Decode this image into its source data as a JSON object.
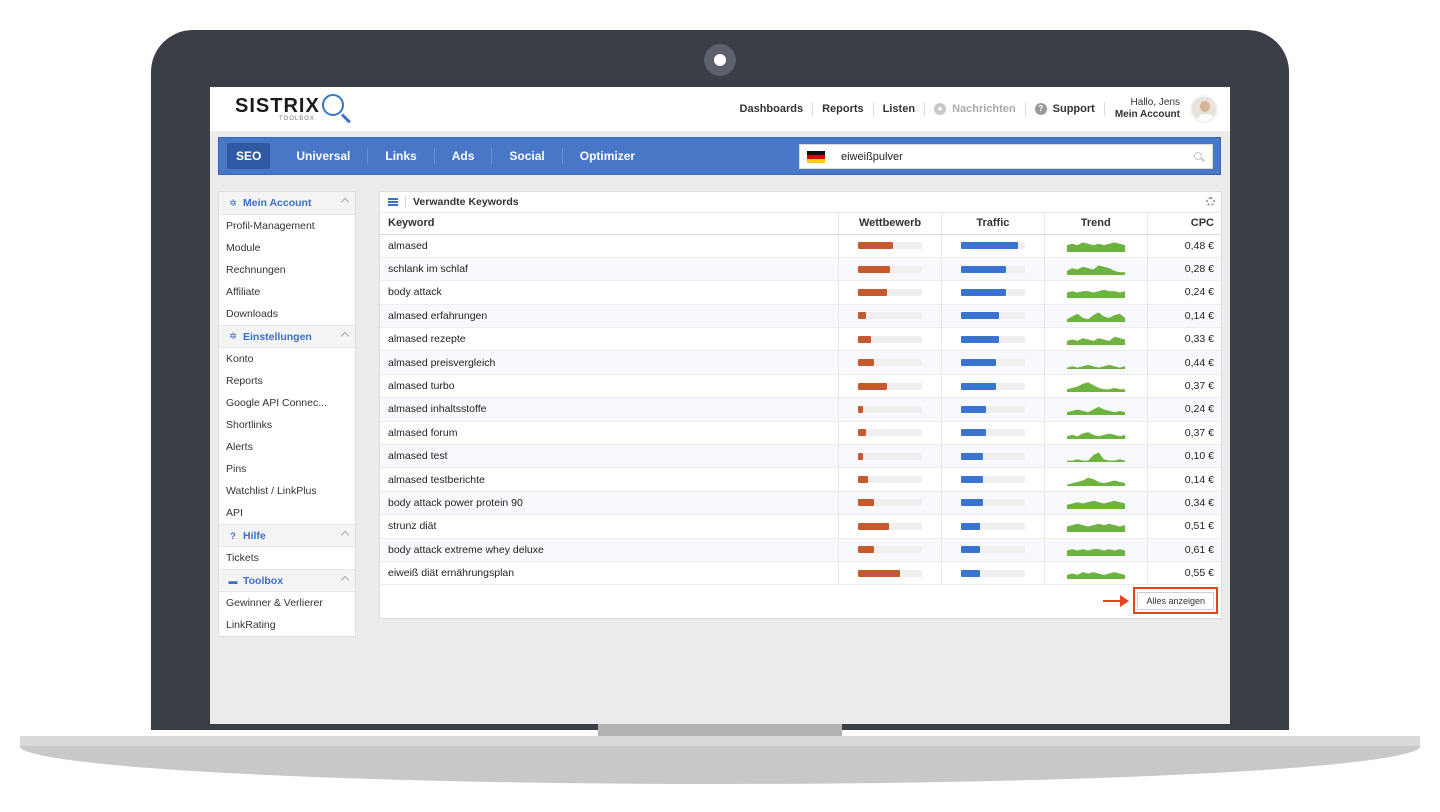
{
  "header": {
    "logo_text": "SISTRIX",
    "logo_sub": "TOOLBOX",
    "nav": [
      "Dashboards",
      "Reports",
      "Listen",
      "Nachrichten",
      "Support"
    ],
    "user_greeting": "Hallo, Jens",
    "user_account": "Mein Account"
  },
  "mainnav": {
    "tabs": [
      "SEO",
      "Universal",
      "Links",
      "Ads",
      "Social",
      "Optimizer"
    ],
    "active_tab": "SEO",
    "search_value": "eiweißpulver",
    "country_flag": "germany-flag"
  },
  "sidebar": {
    "sections": [
      {
        "title": "Mein Account",
        "icon": "gear-icon",
        "items": [
          "Profil-Management",
          "Module",
          "Rechnungen",
          "Affiliate",
          "Downloads"
        ]
      },
      {
        "title": "Einstellungen",
        "icon": "gear-icon",
        "items": [
          "Konto",
          "Reports",
          "Google API Connec...",
          "Shortlinks",
          "Alerts",
          "Pins",
          "Watchlist / LinkPlus",
          "API"
        ]
      },
      {
        "title": "Hilfe",
        "icon": "question-icon",
        "items": [
          "Tickets"
        ]
      },
      {
        "title": "Toolbox",
        "icon": "briefcase-icon",
        "items": [
          "Gewinner & Verlierer",
          "LinkRating"
        ]
      }
    ]
  },
  "panel": {
    "title": "Verwandte Keywords",
    "columns": [
      "Keyword",
      "Wettbewerb",
      "Traffic",
      "Trend",
      "CPC"
    ],
    "show_all_label": "Alles anzeigen",
    "rows": [
      {
        "keyword": "almased",
        "competition": 0.55,
        "traffic": 0.9,
        "trend": [
          5,
          6,
          5,
          7,
          6,
          5,
          6,
          5,
          6,
          7,
          6,
          5
        ],
        "cpc": "0,48 €"
      },
      {
        "keyword": "schlank im schlaf",
        "competition": 0.5,
        "traffic": 0.7,
        "trend": [
          3,
          5,
          4,
          6,
          5,
          4,
          7,
          6,
          5,
          3,
          2,
          2
        ],
        "cpc": "0,28 €"
      },
      {
        "keyword": "body attack",
        "competition": 0.45,
        "traffic": 0.7,
        "trend": [
          4,
          5,
          4,
          5,
          5,
          4,
          5,
          6,
          5,
          5,
          4,
          5
        ],
        "cpc": "0,24 €"
      },
      {
        "keyword": "almased erfahrungen",
        "competition": 0.12,
        "traffic": 0.6,
        "trend": [
          2,
          4,
          6,
          3,
          2,
          5,
          7,
          4,
          3,
          5,
          6,
          3
        ],
        "cpc": "0,14 €"
      },
      {
        "keyword": "almased rezepte",
        "competition": 0.2,
        "traffic": 0.6,
        "trend": [
          3,
          4,
          3,
          5,
          4,
          3,
          5,
          4,
          3,
          6,
          5,
          4
        ],
        "cpc": "0,33 €"
      },
      {
        "keyword": "almased preisvergleich",
        "competition": 0.25,
        "traffic": 0.55,
        "trend": [
          1,
          2,
          1,
          2,
          3,
          2,
          1,
          2,
          3,
          2,
          1,
          2
        ],
        "cpc": "0,44 €"
      },
      {
        "keyword": "almased turbo",
        "competition": 0.45,
        "traffic": 0.55,
        "trend": [
          2,
          3,
          4,
          6,
          7,
          5,
          3,
          2,
          2,
          3,
          2,
          2
        ],
        "cpc": "0,37 €"
      },
      {
        "keyword": "almased inhaltsstoffe",
        "competition": 0.08,
        "traffic": 0.4,
        "trend": [
          2,
          3,
          4,
          3,
          2,
          4,
          6,
          4,
          3,
          2,
          3,
          2
        ],
        "cpc": "0,24 €"
      },
      {
        "keyword": "almased forum",
        "competition": 0.12,
        "traffic": 0.4,
        "trend": [
          2,
          3,
          2,
          4,
          5,
          3,
          2,
          3,
          4,
          3,
          2,
          3
        ],
        "cpc": "0,37 €"
      },
      {
        "keyword": "almased test",
        "competition": 0.08,
        "traffic": 0.35,
        "trend": [
          1,
          1,
          2,
          1,
          1,
          5,
          7,
          2,
          1,
          1,
          2,
          1
        ],
        "cpc": "0,10 €"
      },
      {
        "keyword": "almased testberichte",
        "competition": 0.15,
        "traffic": 0.35,
        "trend": [
          1,
          2,
          3,
          4,
          6,
          5,
          3,
          2,
          3,
          4,
          3,
          2
        ],
        "cpc": "0,14 €"
      },
      {
        "keyword": "body attack power protein 90",
        "competition": 0.25,
        "traffic": 0.35,
        "trend": [
          3,
          4,
          5,
          4,
          5,
          6,
          5,
          4,
          5,
          6,
          5,
          4
        ],
        "cpc": "0,34 €"
      },
      {
        "keyword": "strunz diät",
        "competition": 0.48,
        "traffic": 0.3,
        "trend": [
          4,
          5,
          6,
          5,
          4,
          5,
          6,
          5,
          6,
          5,
          4,
          5
        ],
        "cpc": "0,51 €"
      },
      {
        "keyword": "body attack extreme whey deluxe",
        "competition": 0.25,
        "traffic": 0.3,
        "trend": [
          4,
          5,
          4,
          5,
          4,
          5,
          5,
          4,
          5,
          4,
          5,
          4
        ],
        "cpc": "0,61 €"
      },
      {
        "keyword": "eiweiß diät ernährungsplan",
        "competition": 0.65,
        "traffic": 0.3,
        "trend": [
          3,
          4,
          3,
          5,
          4,
          5,
          4,
          3,
          4,
          5,
          4,
          3
        ],
        "cpc": "0,55 €"
      }
    ]
  },
  "colors": {
    "brand_blue": "#4877c7",
    "competition_bar": "#c65a2e",
    "traffic_bar": "#3b74d0",
    "trend_fill": "#6db33f",
    "highlight": "#e8421e"
  }
}
